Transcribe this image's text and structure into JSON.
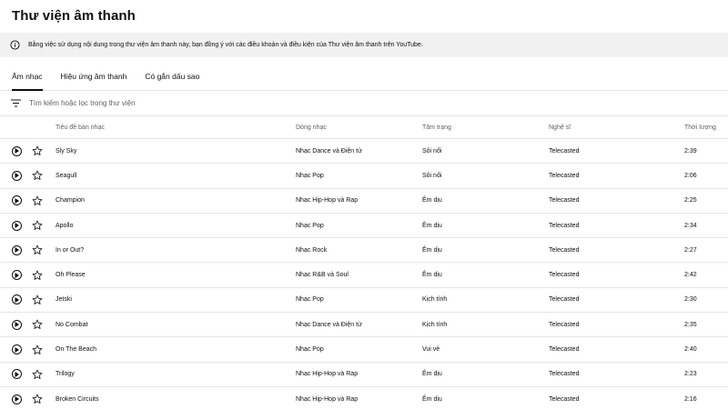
{
  "header": {
    "title": "Thư viện âm thanh"
  },
  "notice": {
    "text": "Bằng việc sử dụng nội dung trong thư viện âm thanh này, bạn đồng ý với các điều khoản và điều kiện của Thư viện âm thanh trên YouTube."
  },
  "tabs": [
    {
      "label": "Âm nhạc",
      "active": true
    },
    {
      "label": "Hiệu ứng âm thanh",
      "active": false
    },
    {
      "label": "Có gắn dấu sao",
      "active": false
    }
  ],
  "filter": {
    "placeholder": "Tìm kiếm hoặc lọc trong thư viện"
  },
  "columns": {
    "title": "Tiêu đề bản nhạc",
    "genre": "Dòng nhạc",
    "mood": "Tâm trạng",
    "artist": "Nghệ sĩ",
    "duration": "Thời lượng"
  },
  "tracks": [
    {
      "title": "Sly Sky",
      "genre": "Nhạc Dance và Điện tử",
      "mood": "Sôi nổi",
      "artist": "Telecasted",
      "duration": "2:39"
    },
    {
      "title": "Seagull",
      "genre": "Nhạc Pop",
      "mood": "Sôi nổi",
      "artist": "Telecasted",
      "duration": "2:06"
    },
    {
      "title": "Champion",
      "genre": "Nhạc Hip-Hop và Rap",
      "mood": "Êm dịu",
      "artist": "Telecasted",
      "duration": "2:25"
    },
    {
      "title": "Apollo",
      "genre": "Nhạc Pop",
      "mood": "Êm dịu",
      "artist": "Telecasted",
      "duration": "2:34"
    },
    {
      "title": "In or Out?",
      "genre": "Nhạc Rock",
      "mood": "Êm dịu",
      "artist": "Telecasted",
      "duration": "2:27"
    },
    {
      "title": "Oh Please",
      "genre": "Nhạc R&B và Soul",
      "mood": "Êm dịu",
      "artist": "Telecasted",
      "duration": "2:42"
    },
    {
      "title": "Jetski",
      "genre": "Nhạc Pop",
      "mood": "Kịch tính",
      "artist": "Telecasted",
      "duration": "2:30"
    },
    {
      "title": "No Combat",
      "genre": "Nhạc Dance và Điện tử",
      "mood": "Kịch tính",
      "artist": "Telecasted",
      "duration": "2:35"
    },
    {
      "title": "On The Beach",
      "genre": "Nhạc Pop",
      "mood": "Vui vẻ",
      "artist": "Telecasted",
      "duration": "2:40"
    },
    {
      "title": "Trilogy",
      "genre": "Nhạc Hip-Hop và Rap",
      "mood": "Êm dịu",
      "artist": "Telecasted",
      "duration": "2:23"
    },
    {
      "title": "Broken Circuits",
      "genre": "Nhạc Hip-Hop và Rap",
      "mood": "Êm dịu",
      "artist": "Telecasted",
      "duration": "2:16"
    }
  ],
  "icons": {
    "notice": "info-icon",
    "filter": "filter-icon",
    "play": "play-icon",
    "star": "star-outline-icon"
  }
}
